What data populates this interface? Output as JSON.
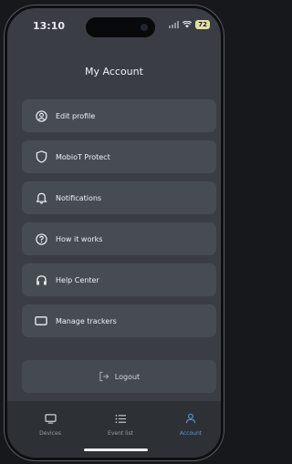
{
  "status_bar": {
    "time": "13:10",
    "battery": "72"
  },
  "header": {
    "title": "My Account"
  },
  "menu": [
    {
      "label": "Edit profile",
      "icon": "user-circle-icon"
    },
    {
      "label": "MobioT Protect",
      "icon": "shield-icon"
    },
    {
      "label": "Notifications",
      "icon": "bell-icon"
    },
    {
      "label": "How it works",
      "icon": "help-circle-icon"
    },
    {
      "label": "Help Center",
      "icon": "headphones-icon"
    },
    {
      "label": "Manage trackers",
      "icon": "tracker-icon"
    }
  ],
  "logout": {
    "label": "Logout",
    "icon": "logout-icon"
  },
  "tabs": [
    {
      "label": "Devices",
      "icon": "devices-icon",
      "active": false
    },
    {
      "label": "Event list",
      "icon": "list-icon",
      "active": false
    },
    {
      "label": "Account",
      "icon": "account-icon",
      "active": true
    }
  ],
  "colors": {
    "background": "#3a3e44",
    "card": "#474c53",
    "accent": "#5e93d6",
    "tabbar": "#2d3136"
  }
}
